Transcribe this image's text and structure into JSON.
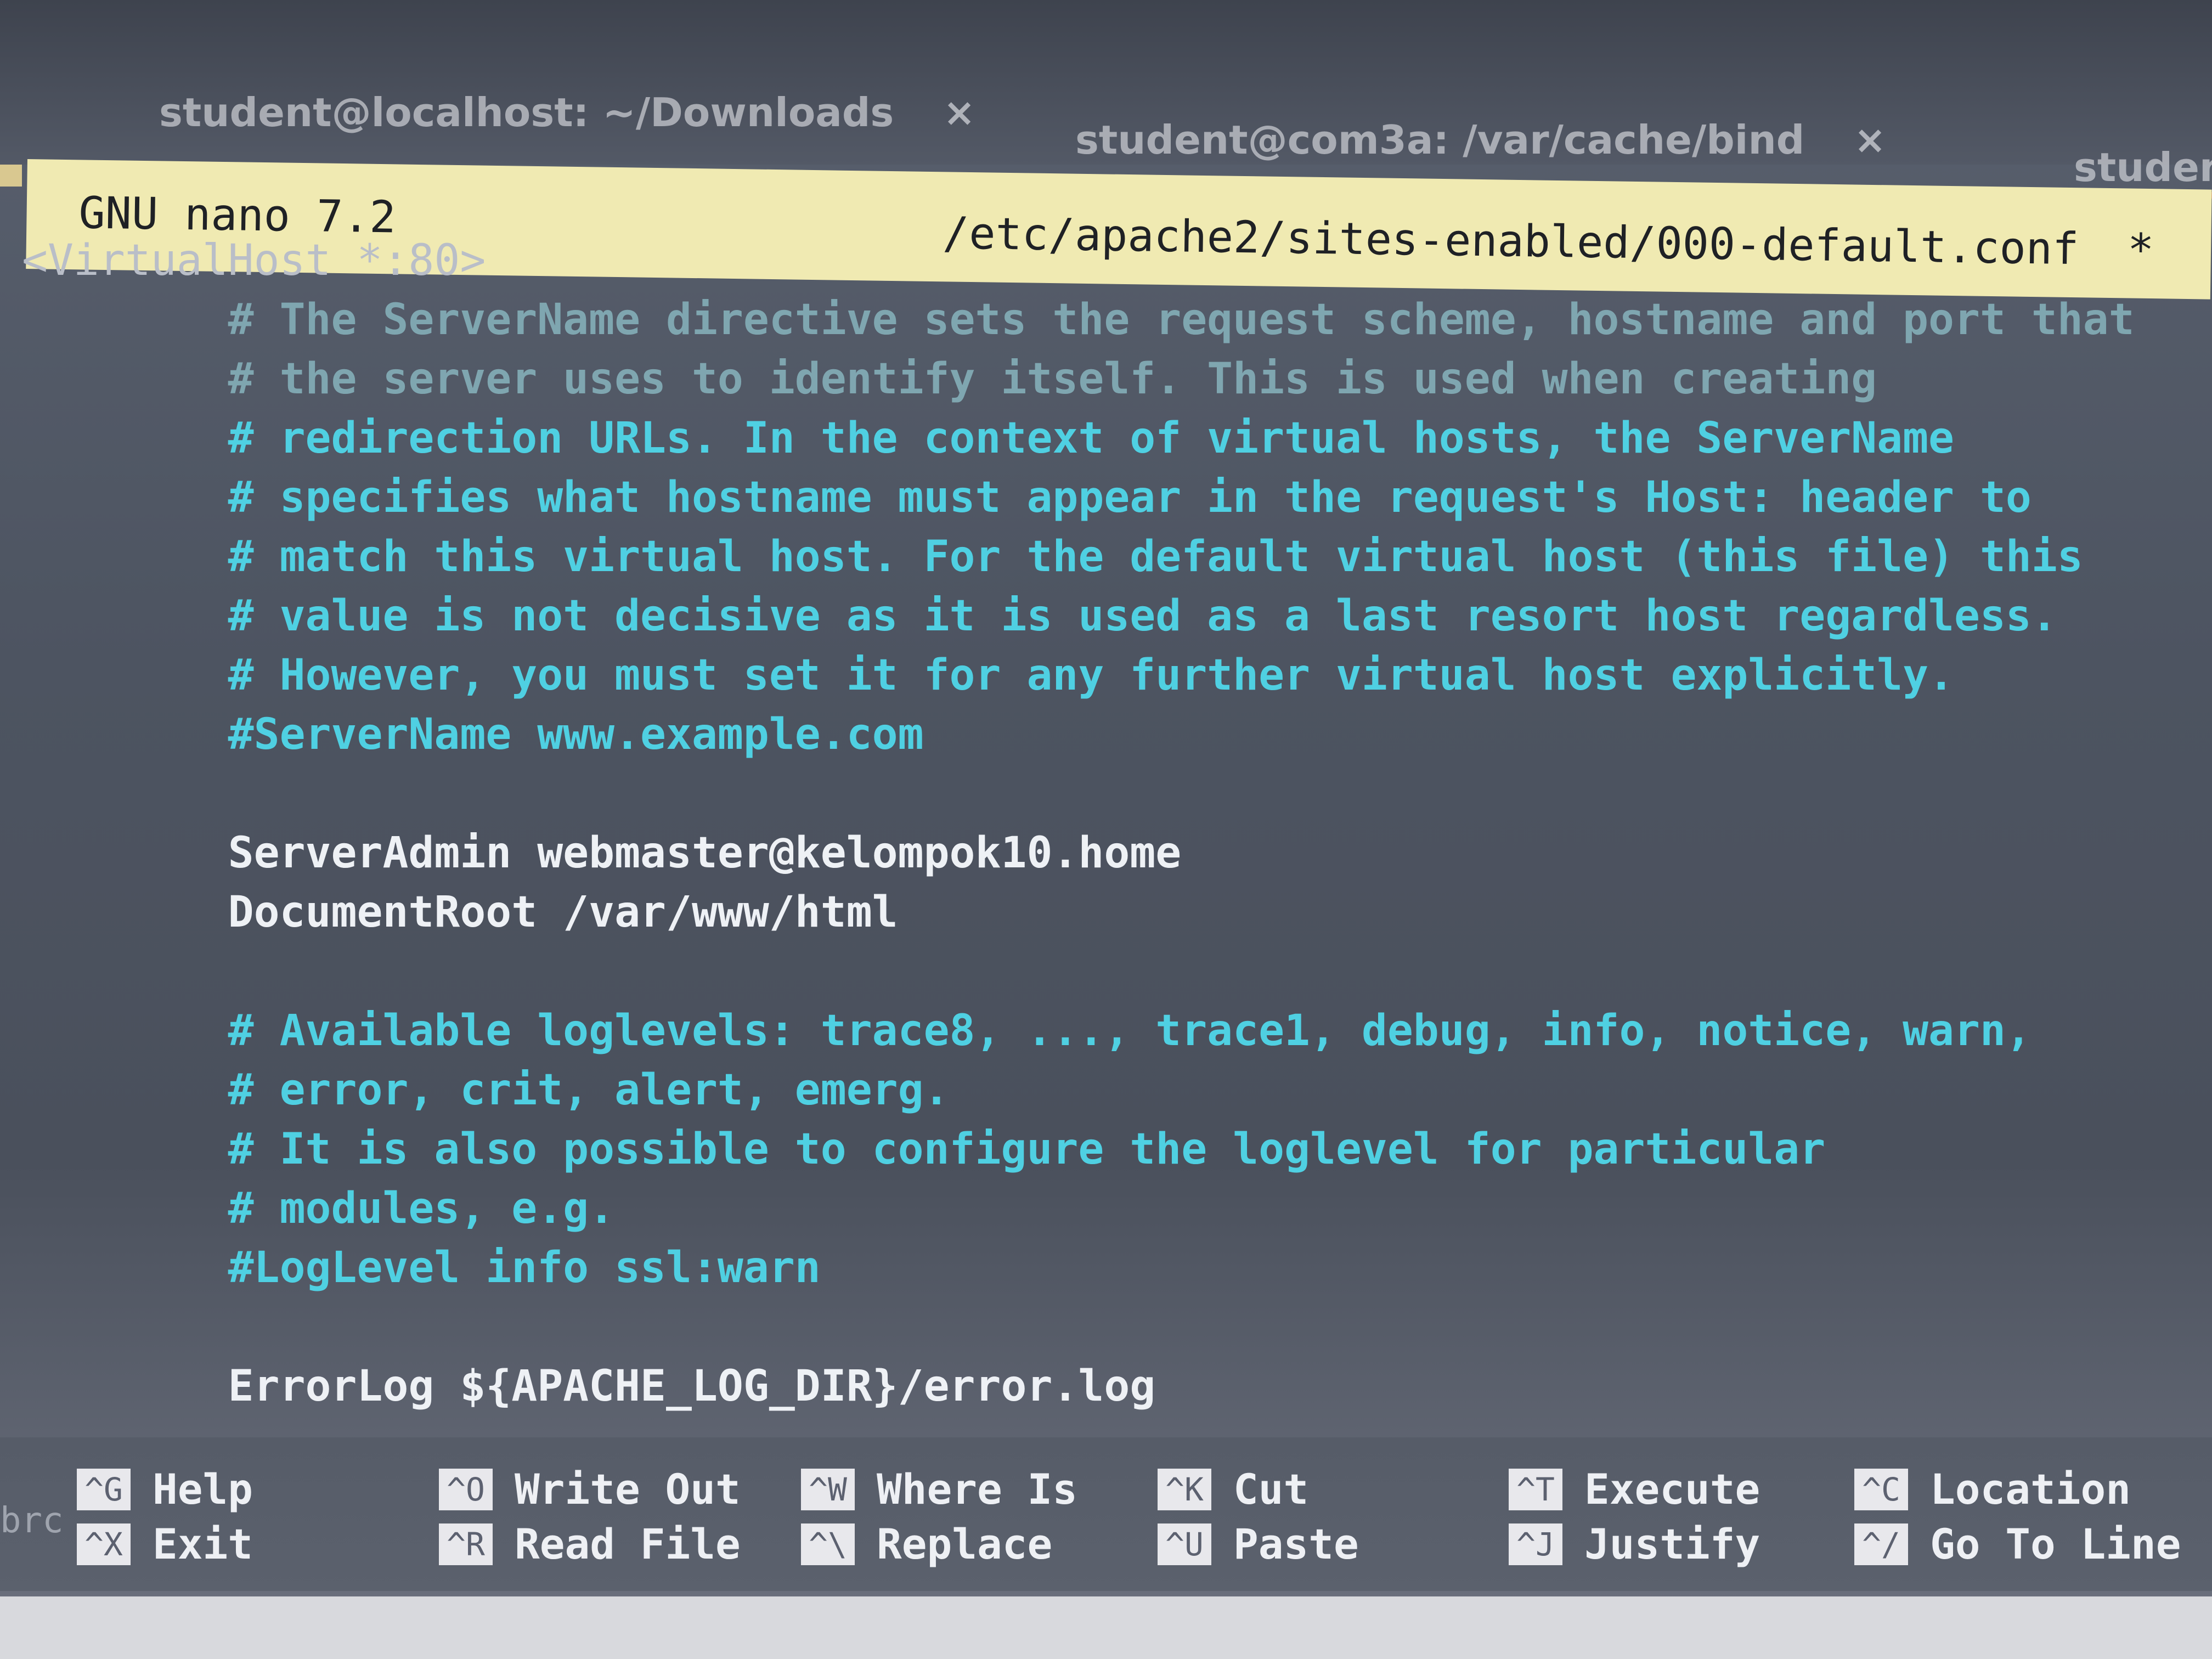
{
  "tabs": [
    {
      "label": "student@localhost: ~/Downloads",
      "close": "×"
    },
    {
      "label": "student@com3a: /var/cache/bind",
      "close": "×"
    },
    {
      "label": "student"
    }
  ],
  "titlebar": {
    "app": "GNU  nano 7.2",
    "file": "/etc/apache2/sites-enabled/000-default.conf",
    "modified": "*"
  },
  "lines": [
    "<VirtualHost *:80>",
    "        # The ServerName directive sets the request scheme, hostname and port that",
    "        # the server uses to identify itself. This is used when creating",
    "        # redirection URLs. In the context of virtual hosts, the ServerName",
    "        # specifies what hostname must appear in the request's Host: header to",
    "        # match this virtual host. For the default virtual host (this file) this",
    "        # value is not decisive as it is used as a last resort host regardless.",
    "        # However, you must set it for any further virtual host explicitly.",
    "        #ServerName www.example.com",
    "",
    "        ServerAdmin webmaster@kelompok10.home",
    "        DocumentRoot /var/www/html",
    "",
    "        # Available loglevels: trace8, ..., trace1, debug, info, notice, warn,",
    "        # error, crit, alert, emerg.",
    "        # It is also possible to configure the loglevel for particular",
    "        # modules, e.g.",
    "        #LogLevel info ssl:warn",
    "",
    "        ErrorLog ${APACHE_LOG_DIR}/error.log"
  ],
  "shortcuts": [
    {
      "key": "^G",
      "label": "Help"
    },
    {
      "key": "^X",
      "label": "Exit"
    },
    {
      "key": "^O",
      "label": "Write Out"
    },
    {
      "key": "^R",
      "label": "Read File"
    },
    {
      "key": "^W",
      "label": "Where Is"
    },
    {
      "key": "^\\",
      "label": "Replace"
    },
    {
      "key": "^K",
      "label": "Cut"
    },
    {
      "key": "^U",
      "label": "Paste"
    },
    {
      "key": "^T",
      "label": "Execute"
    },
    {
      "key": "^J",
      "label": "Justify"
    },
    {
      "key": "^C",
      "label": "Location"
    },
    {
      "key": "^/",
      "label": "Go To Line"
    }
  ],
  "edge_text": "brc",
  "colors": {
    "comment": "#4fd0e2",
    "code": "#eef1f5",
    "titlebar_bg": "#f0eab2",
    "background": "#4d5461"
  }
}
